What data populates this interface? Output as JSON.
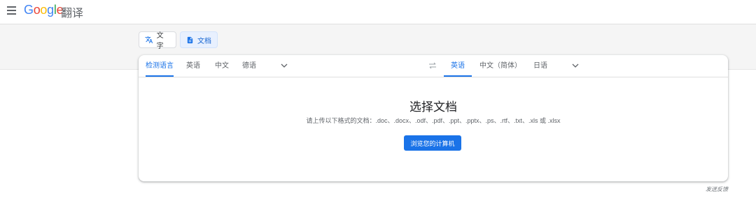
{
  "header": {
    "logo_text": [
      "G",
      "o",
      "o",
      "g",
      "l",
      "e"
    ],
    "product_name": "翻译"
  },
  "modes": {
    "text_label": "文字",
    "doc_label": "文档"
  },
  "source_languages": [
    "检测语言",
    "英语",
    "中文",
    "德语"
  ],
  "target_languages": [
    "英语",
    "中文（简体）",
    "日语"
  ],
  "main": {
    "title": "选择文档",
    "subtitle": "请上传以下格式的文档：.doc、.docx、.odf、.pdf、.ppt、.pptx、.ps、.rtf、.txt、.xls 或 .xlsx",
    "browse_label": "浏览您的计算机"
  },
  "footer": {
    "feedback": "发送反馈"
  },
  "colors": {
    "accent": "#1a73e8",
    "band": "#f5f5f5"
  },
  "icons": [
    "menu-icon",
    "translate-icon",
    "document-icon",
    "chevron-down-icon",
    "swap-icon"
  ]
}
